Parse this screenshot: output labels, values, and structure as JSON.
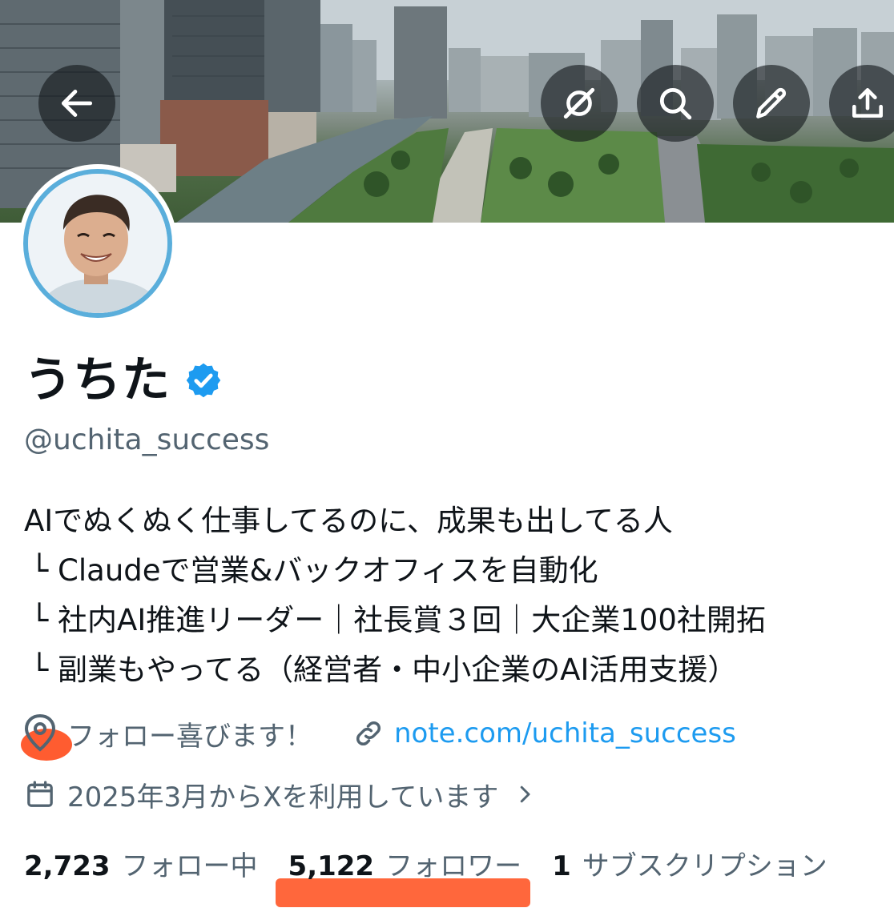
{
  "header": {
    "back_icon": "arrow-left-icon",
    "action_icons": [
      "grok-icon",
      "search-icon",
      "edit-icon",
      "share-icon"
    ]
  },
  "profile": {
    "display_name": "うちた",
    "verified": true,
    "verified_color": "#1d9bf0",
    "handle": "@uchita_success",
    "bio_lines": [
      "AIでぬくぬく仕事してるのに、成果も出してる人",
      "└ Claudeで営業&バックオフィスを自動化",
      "└ 社内AI推進リーダー｜社長賞３回｜大企業100社開拓",
      "└ 副業もやってる（経営者・中小企業のAI活用支援）"
    ],
    "location": "フォロー喜びます！",
    "website": "note.com/uchita_success",
    "joined": "2025年3月からXを利用しています"
  },
  "stats": {
    "following_count": "2,723",
    "following_label": "フォロー中",
    "followers_count": "5,122",
    "followers_label": "フォロワー",
    "subscriptions_count": "1",
    "subscriptions_label": "サブスクリプション"
  },
  "colors": {
    "link": "#1d9bf0",
    "secondary_text": "#536471",
    "avatar_ring": "#5aaedb",
    "highlight_annotation": "#ff5a2b"
  }
}
